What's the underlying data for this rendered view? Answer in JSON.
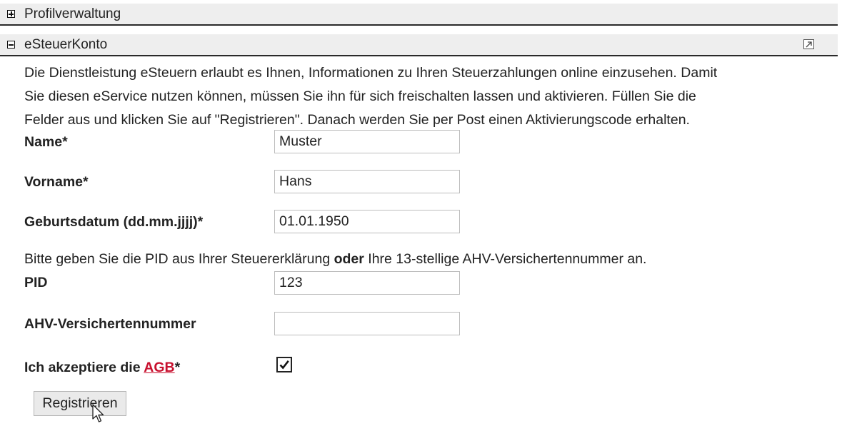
{
  "sections": {
    "profil": {
      "title": "Profilverwaltung",
      "toggle_icon": "plus-box-icon"
    },
    "esteuer": {
      "title": "eSteuerKonto",
      "toggle_icon": "minus-box-icon",
      "popout_icon": "popout-arrow-icon"
    }
  },
  "intro": {
    "line1": "Die Dienstleistung eSteuern erlaubt es Ihnen, Informationen zu Ihren Steuerzahlungen online einzusehen. Damit",
    "line2": "Sie diesen eService nutzen können, müssen Sie ihn für sich freischalten lassen und aktivieren. Füllen Sie die",
    "line3": "Felder aus und klicken Sie auf \"Registrieren\". Danach werden Sie per Post einen Aktivierungscode erhalten."
  },
  "form": {
    "name": {
      "label": "Name*",
      "value": "Muster"
    },
    "vorname": {
      "label": "Vorname*",
      "value": "Hans"
    },
    "geburtsdatum": {
      "label": "Geburtsdatum (dd.mm.jjjj)*",
      "value": "01.01.1950"
    },
    "pid_note": {
      "before": "Bitte geben Sie die PID aus Ihrer Steuererklärung ",
      "bold": "oder",
      "after": " Ihre 13-stellige AHV-Versichertennummer an."
    },
    "pid": {
      "label": "PID",
      "value": "123"
    },
    "ahv": {
      "label": "AHV-Versichertennummer",
      "value": ""
    },
    "agb": {
      "label_prefix": "Ich akzeptiere die ",
      "link": "AGB",
      "label_suffix": "*",
      "checked": true
    },
    "submit_label": "Registrieren"
  },
  "colors": {
    "link": "#c8102e",
    "header_bg": "#eeeeee"
  }
}
